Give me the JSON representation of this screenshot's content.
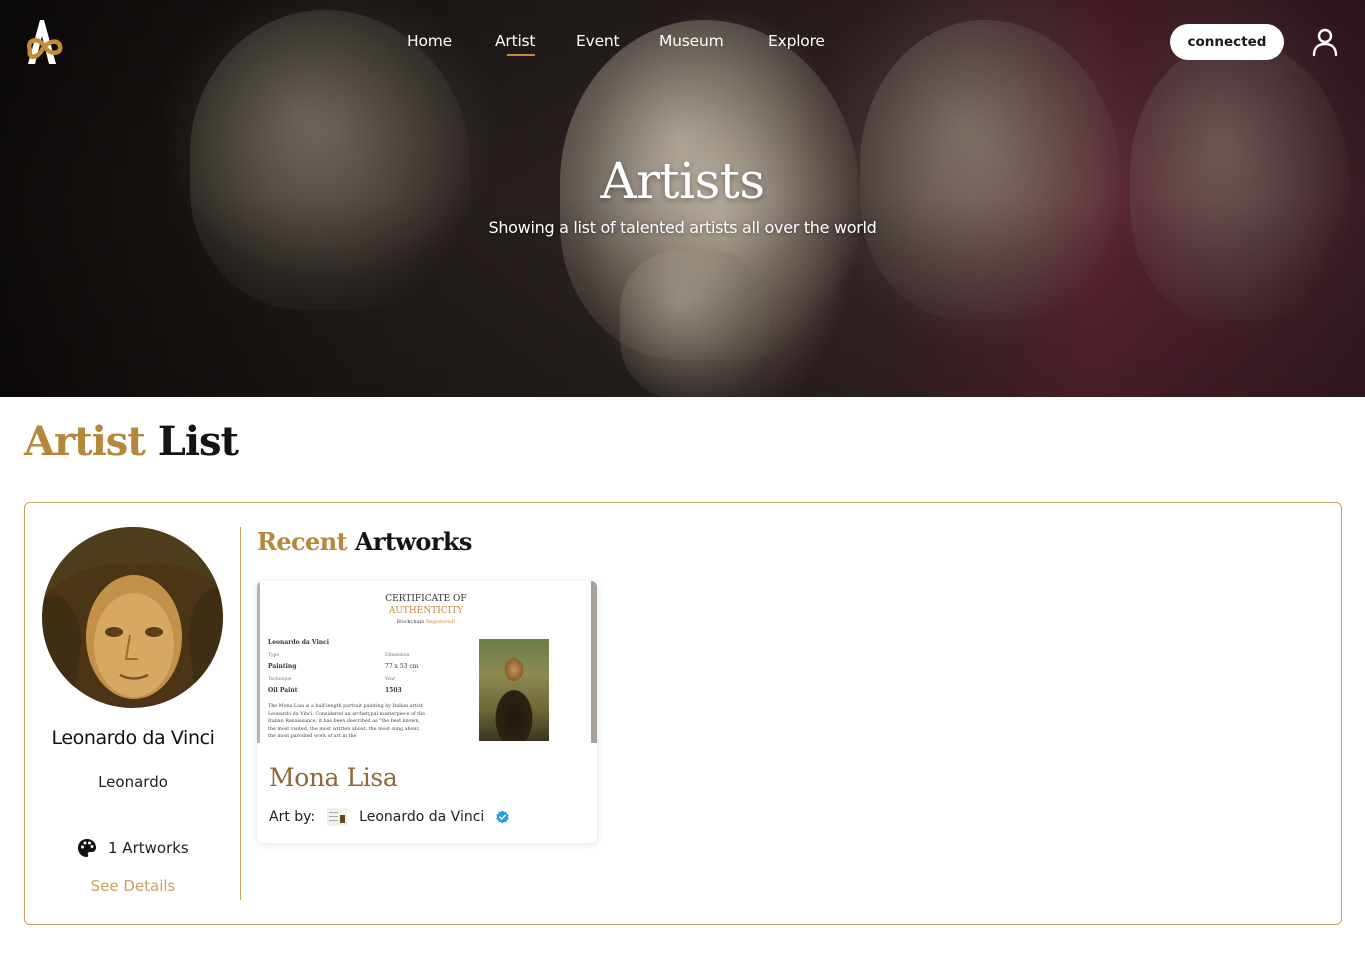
{
  "header": {
    "nav": [
      {
        "label": "Home",
        "active": false
      },
      {
        "label": "Artist",
        "active": true
      },
      {
        "label": "Event",
        "active": false
      },
      {
        "label": "Museum",
        "active": false
      },
      {
        "label": "Explore",
        "active": false
      }
    ],
    "connect_label": "connected"
  },
  "hero": {
    "title": "Artists",
    "subtitle": "Showing a list of talented artists all over the world"
  },
  "section": {
    "title_accent": "Artist",
    "title_rest": "List"
  },
  "artist": {
    "name": "Leonardo da Vinci",
    "username": "Leonardo",
    "artworks_count": "1 Artworks",
    "details_label": "See Details"
  },
  "recent": {
    "title_accent": "Recent",
    "title_rest": "Artworks",
    "items": [
      {
        "title": "Mona Lisa",
        "by_label": "Art by:",
        "artist": "Leonardo da Vinci",
        "verified": true,
        "certificate": {
          "heading_1": "CERTIFICATE OF",
          "heading_2": "AUTHENTICITY",
          "chain_label": "Blockchain",
          "chain_status": "Registered!",
          "artist": "Leonardo da Vinci",
          "type_label": "Type",
          "type": "Painting",
          "technique_label": "Technique",
          "technique": "Oil Paint",
          "dimension_label": "Dimension",
          "dimension": "77 x 53 cm",
          "year_label": "Year",
          "year": "1503",
          "description": "The Mona Lisa is a half-length portrait painting by Italian artist Leonardo da Vinci. Considered an archetypal masterpiece of the Italian Renaissance, it has been described as \"the best known, the most visited, the most written about, the most sung about, the most parodied work of art in the"
        }
      }
    ]
  },
  "colors": {
    "accent_gold": "#b5873d",
    "border_gold": "#c8a266",
    "link_gold": "#c9a25f",
    "verify_blue": "#2d9cdb"
  }
}
